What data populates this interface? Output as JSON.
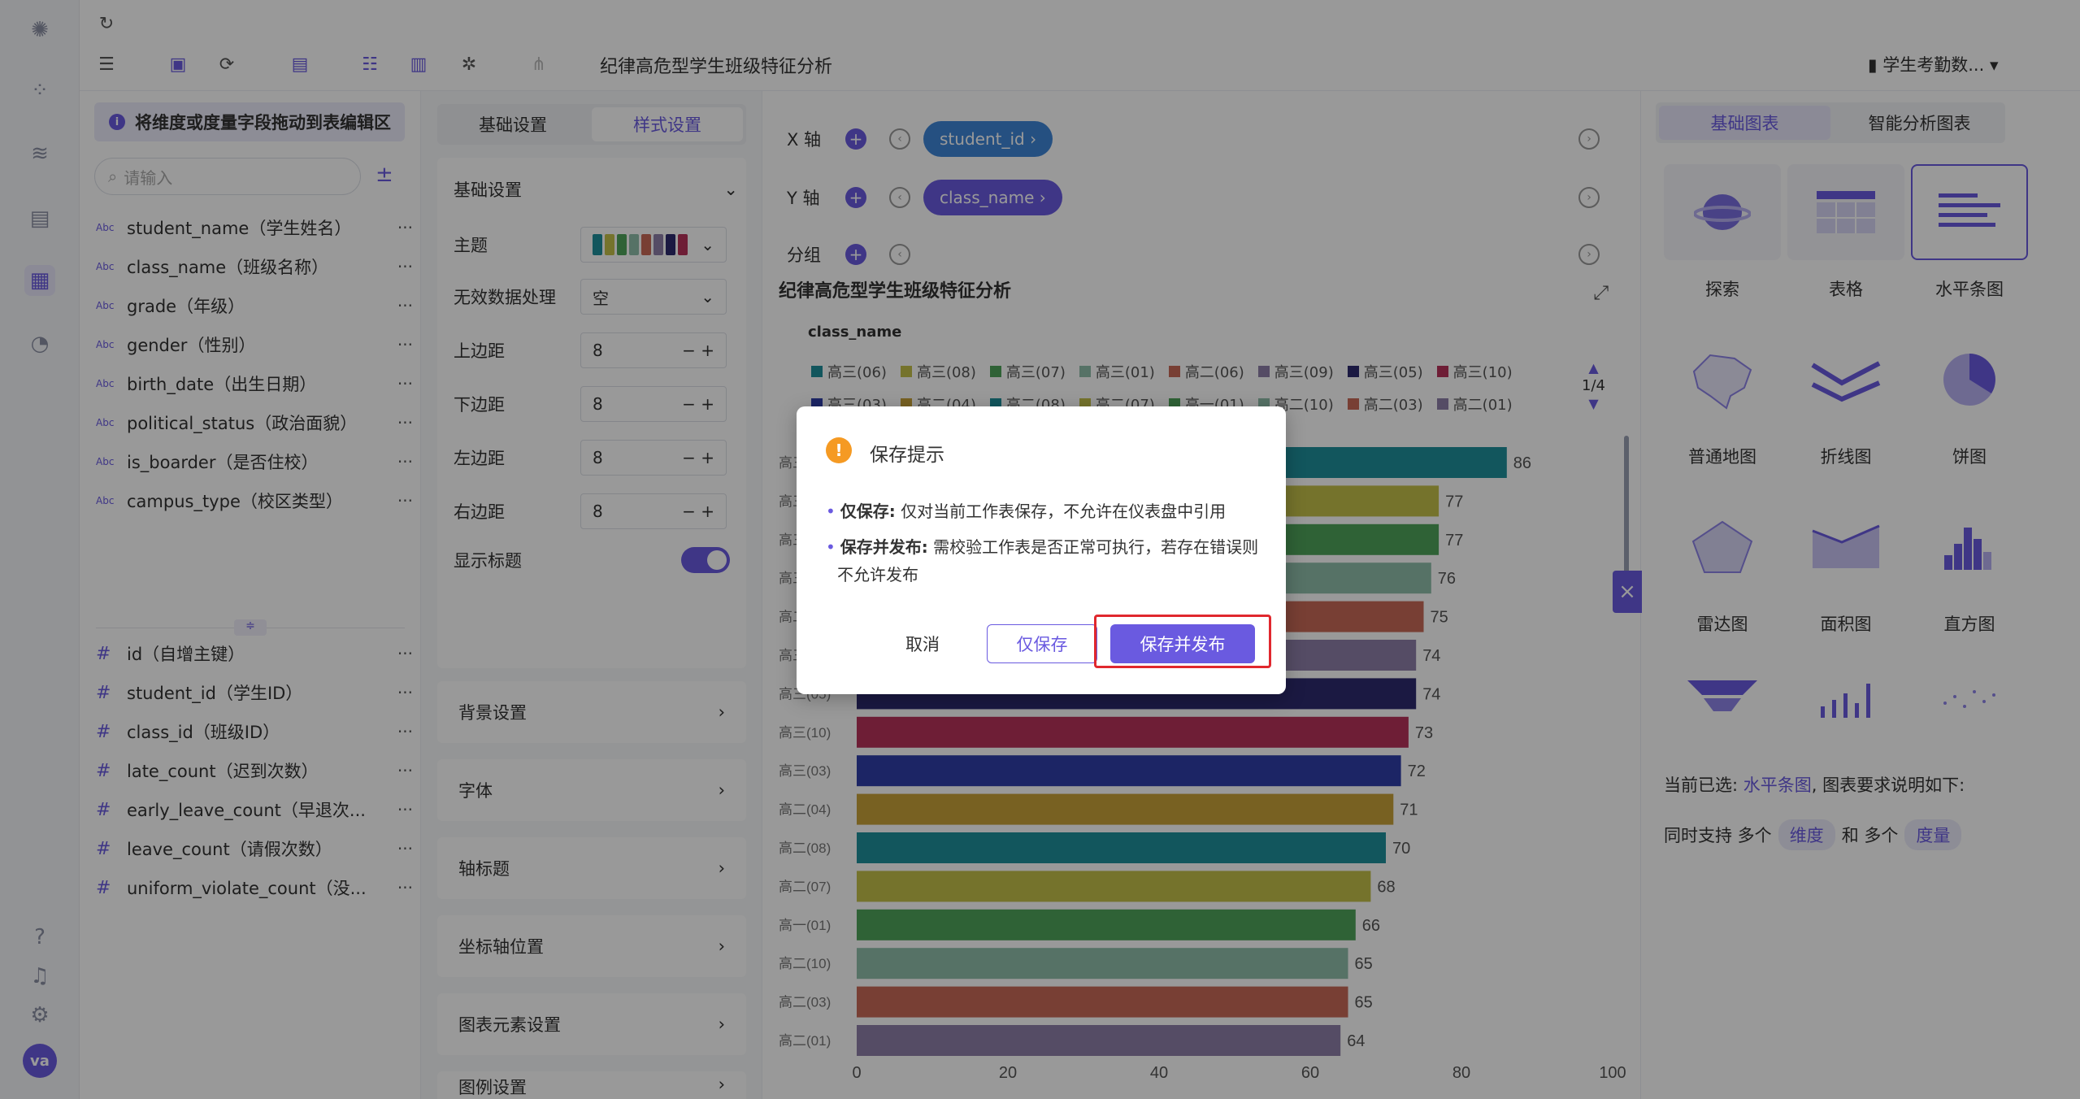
{
  "topbar": {
    "title": "纪律高危型学生班级特征分析",
    "dataset": "学生考勤数..."
  },
  "fieldpanel": {
    "hint": "将维度或度量字段拖动到表编辑区",
    "search_placeholder": "请输入",
    "dimensions": [
      {
        "type": "Abc",
        "name": "student_name（学生姓名）"
      },
      {
        "type": "Abc",
        "name": "class_name（班级名称）"
      },
      {
        "type": "Abc",
        "name": "grade（年级）"
      },
      {
        "type": "Abc",
        "name": "gender（性别）"
      },
      {
        "type": "Abc",
        "name": "birth_date（出生日期）"
      },
      {
        "type": "Abc",
        "name": "political_status（政治面貌）"
      },
      {
        "type": "Abc",
        "name": "is_boarder（是否住校）"
      },
      {
        "type": "Abc",
        "name": "campus_type（校区类型）"
      }
    ],
    "measures": [
      {
        "type": "#",
        "name": "id（自增主键）"
      },
      {
        "type": "#",
        "name": "student_id（学生ID）"
      },
      {
        "type": "#",
        "name": "class_id（班级ID）"
      },
      {
        "type": "#",
        "name": "late_count（迟到次数）"
      },
      {
        "type": "#",
        "name": "early_leave_count（早退次..."
      },
      {
        "type": "#",
        "name": "leave_count（请假次数）"
      },
      {
        "type": "#",
        "name": "uniform_violate_count（没..."
      }
    ],
    "more": "···"
  },
  "settings": {
    "tab_basic": "基础设置",
    "tab_style": "样式设置",
    "section_basic": "基础设置",
    "theme_label": "主题",
    "invalid_label": "无效数据处理",
    "invalid_value": "空",
    "top_margin_label": "上边距",
    "top_margin": "8",
    "bottom_margin_label": "下边距",
    "bottom_margin": "8",
    "left_margin_label": "左边距",
    "left_margin": "8",
    "right_margin_label": "右边距",
    "right_margin": "8",
    "show_title_label": "显示标题",
    "sections": [
      "背景设置",
      "字体",
      "轴标题",
      "坐标轴位置",
      "图表元素设置",
      "图例设置"
    ]
  },
  "main": {
    "x_label": "X 轴",
    "x_field": "student_id ›",
    "y_label": "Y 轴",
    "y_field": "class_name ›",
    "group_label": "分组",
    "chart_title": "纪律高危型学生班级特征分析",
    "legend_title": "class_name",
    "pager": "1/4"
  },
  "chart_data": {
    "type": "bar",
    "orientation": "horizontal",
    "title": "纪律高危型学生班级特征分析",
    "legend_title": "class_name",
    "legend_row1": [
      {
        "name": "高三(06)",
        "color": "#1f8f9c"
      },
      {
        "name": "高三(08)",
        "color": "#c4c04a"
      },
      {
        "name": "高三(07)",
        "color": "#4fa35a"
      },
      {
        "name": "高三(01)",
        "color": "#8fbfaa"
      },
      {
        "name": "高二(06)",
        "color": "#c86a58"
      },
      {
        "name": "高三(09)",
        "color": "#8e7fa8"
      },
      {
        "name": "高三(05)",
        "color": "#2e2a6e"
      },
      {
        "name": "高三(10)",
        "color": "#b8325a"
      }
    ],
    "legend_row2": [
      {
        "name": "高三(03)",
        "color": "#2f3fa8"
      },
      {
        "name": "高二(04)",
        "color": "#c8a23a"
      },
      {
        "name": "高二(08)",
        "color": "#1f8f9c"
      },
      {
        "name": "高二(07)",
        "color": "#c4c04a"
      },
      {
        "name": "高一(01)",
        "color": "#4fa35a"
      },
      {
        "name": "高二(10)",
        "color": "#8fbfaa"
      },
      {
        "name": "高二(03)",
        "color": "#c86a58"
      },
      {
        "name": "高二(01)",
        "color": "#8e7fa8"
      }
    ],
    "categories": [
      "高三(06)",
      "高三(08)",
      "高三(07)",
      "高三(01)",
      "高二(06)",
      "高三(09)",
      "高三(05)",
      "高三(10)",
      "高三(03)",
      "高二(04)",
      "高二(08)",
      "高二(07)",
      "高一(01)",
      "高二(10)",
      "高二(03)",
      "高二(01)"
    ],
    "values": [
      86,
      77,
      77,
      76,
      75,
      74,
      74,
      73,
      72,
      71,
      70,
      68,
      66,
      65,
      65,
      64
    ],
    "colors": [
      "#1f8f9c",
      "#c4c04a",
      "#4fa35a",
      "#8fbfaa",
      "#c86a58",
      "#8e7fa8",
      "#2e2a6e",
      "#b8325a",
      "#2f3fa8",
      "#c8a23a",
      "#1f8f9c",
      "#c4c04a",
      "#4fa35a",
      "#8fbfaa",
      "#c86a58",
      "#8e7fa8"
    ],
    "xlim": [
      0,
      100
    ],
    "xticks": [
      0,
      20,
      40,
      60,
      80,
      100
    ],
    "visible_labels": [
      "高三(10)",
      "高三(03)",
      "高二(04)",
      "高二(08)",
      "高二(07)",
      "高一(01)",
      "高二(10)",
      "高二(03)",
      "高二(01)"
    ]
  },
  "rightpanel": {
    "tab_basic": "基础图表",
    "tab_smart": "智能分析图表",
    "types": [
      "探索",
      "表格",
      "水平条图",
      "普通地图",
      "折线图",
      "饼图",
      "雷达图",
      "面积图",
      "直方图"
    ],
    "current_prefix": "当前已选:",
    "current_type": "水平条图",
    "current_suffix": ", 图表要求说明如下:",
    "support_prefix": "同时支持 多个",
    "tag_dim": "维度",
    "support_mid": "和 多个",
    "tag_measure": "度量"
  },
  "modal": {
    "title": "保存提示",
    "save_only_label": "仅保存:",
    "save_only_desc": "仅对当前工作表保存，不允许在仪表盘中引用",
    "save_publish_label": "保存并发布:",
    "save_publish_desc": "需校验工作表是否正常可执行，若存在错误则不允许发布",
    "cancel": "取消",
    "save_only": "仅保存",
    "save_publish": "保存并发布"
  }
}
